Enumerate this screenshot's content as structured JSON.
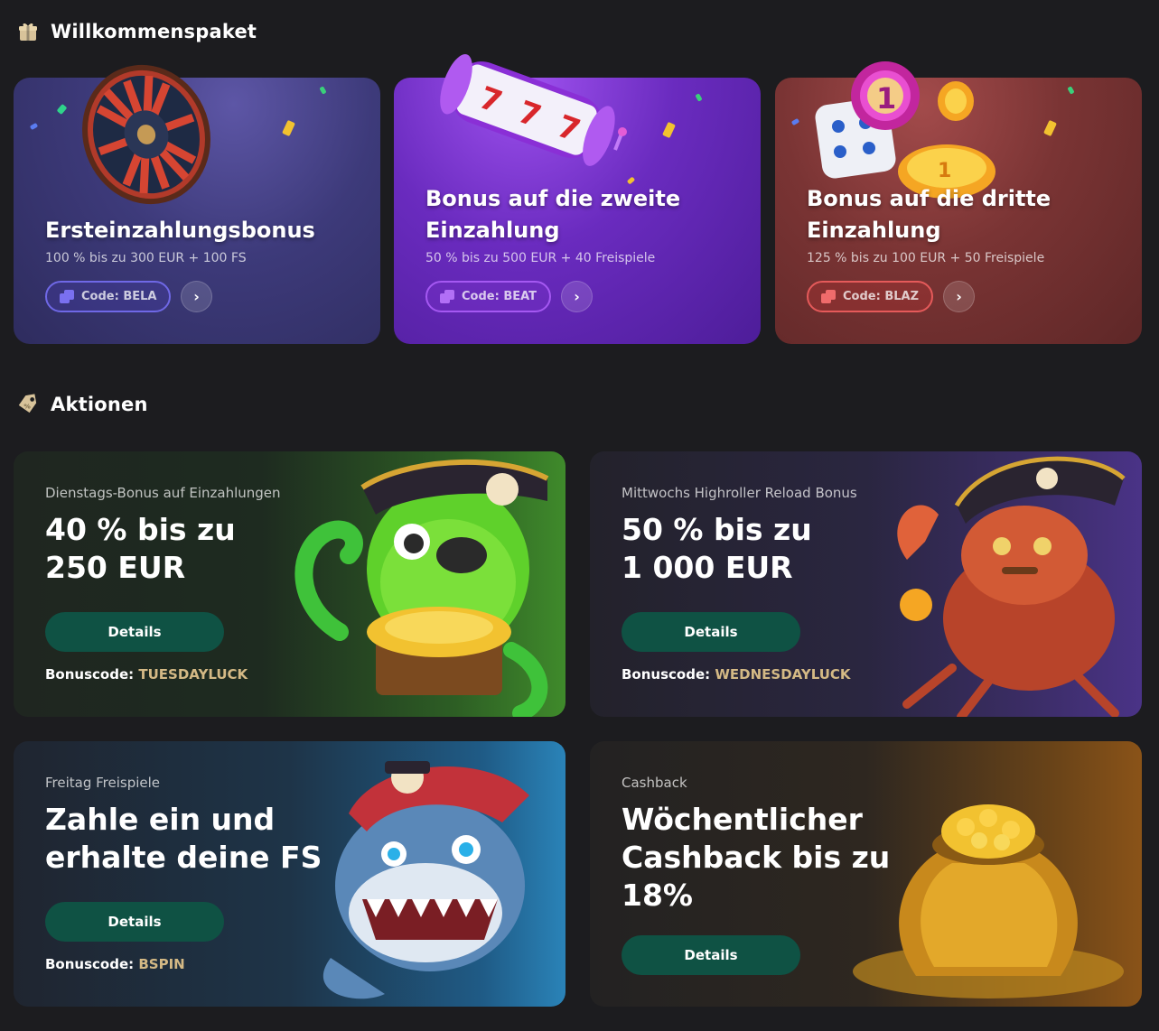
{
  "welcome": {
    "heading": "Willkommenspaket",
    "icon": "gift-icon",
    "cards": [
      {
        "title": "Ersteinzahlungsbonus",
        "subtitle": "100 % bis zu 300 EUR + 100 FS",
        "code": "Code: BELA",
        "art": "roulette-wheel"
      },
      {
        "title_line1": "Bonus auf die zweite",
        "title_line2": "Einzahlung",
        "subtitle": "50 % bis zu 500 EUR + 40 Freispiele",
        "code": "Code: BEAT",
        "art": "slot-reels"
      },
      {
        "title_line1": "Bonus auf die dritte",
        "title_line2": "Einzahlung",
        "subtitle": "125 % bis zu 100 EUR + 50 Freispiele",
        "code": "Code: BLAZ",
        "art": "dice-and-chips"
      }
    ]
  },
  "promotions": {
    "heading": "Aktionen",
    "icon": "tag-icon",
    "details_label": "Details",
    "bonuscode_label": "Bonuscode:",
    "cards": [
      {
        "label": "Dienstags-Bonus auf Einzahlungen",
        "headline_line1": "40 % bis zu",
        "headline_line2": "250 EUR",
        "code": "TUESDAYLUCK",
        "art": "octopus-pirate"
      },
      {
        "label": "Mittwochs Highroller Reload Bonus",
        "headline_line1": "50 % bis zu",
        "headline_line2": "1 000 EUR",
        "code": "WEDNESDAYLUCK",
        "art": "crab-pirate"
      },
      {
        "label": "Freitag Freispiele",
        "headline_line1": "Zahle ein und",
        "headline_line2": "erhalte deine FS",
        "code": "BSPIN",
        "art": "shark-pirate"
      },
      {
        "label": "Cashback",
        "headline_line1": "Wöchentlicher",
        "headline_line2": "Cashback bis zu",
        "headline_line3": "18%",
        "art": "gold-sack"
      }
    ]
  }
}
